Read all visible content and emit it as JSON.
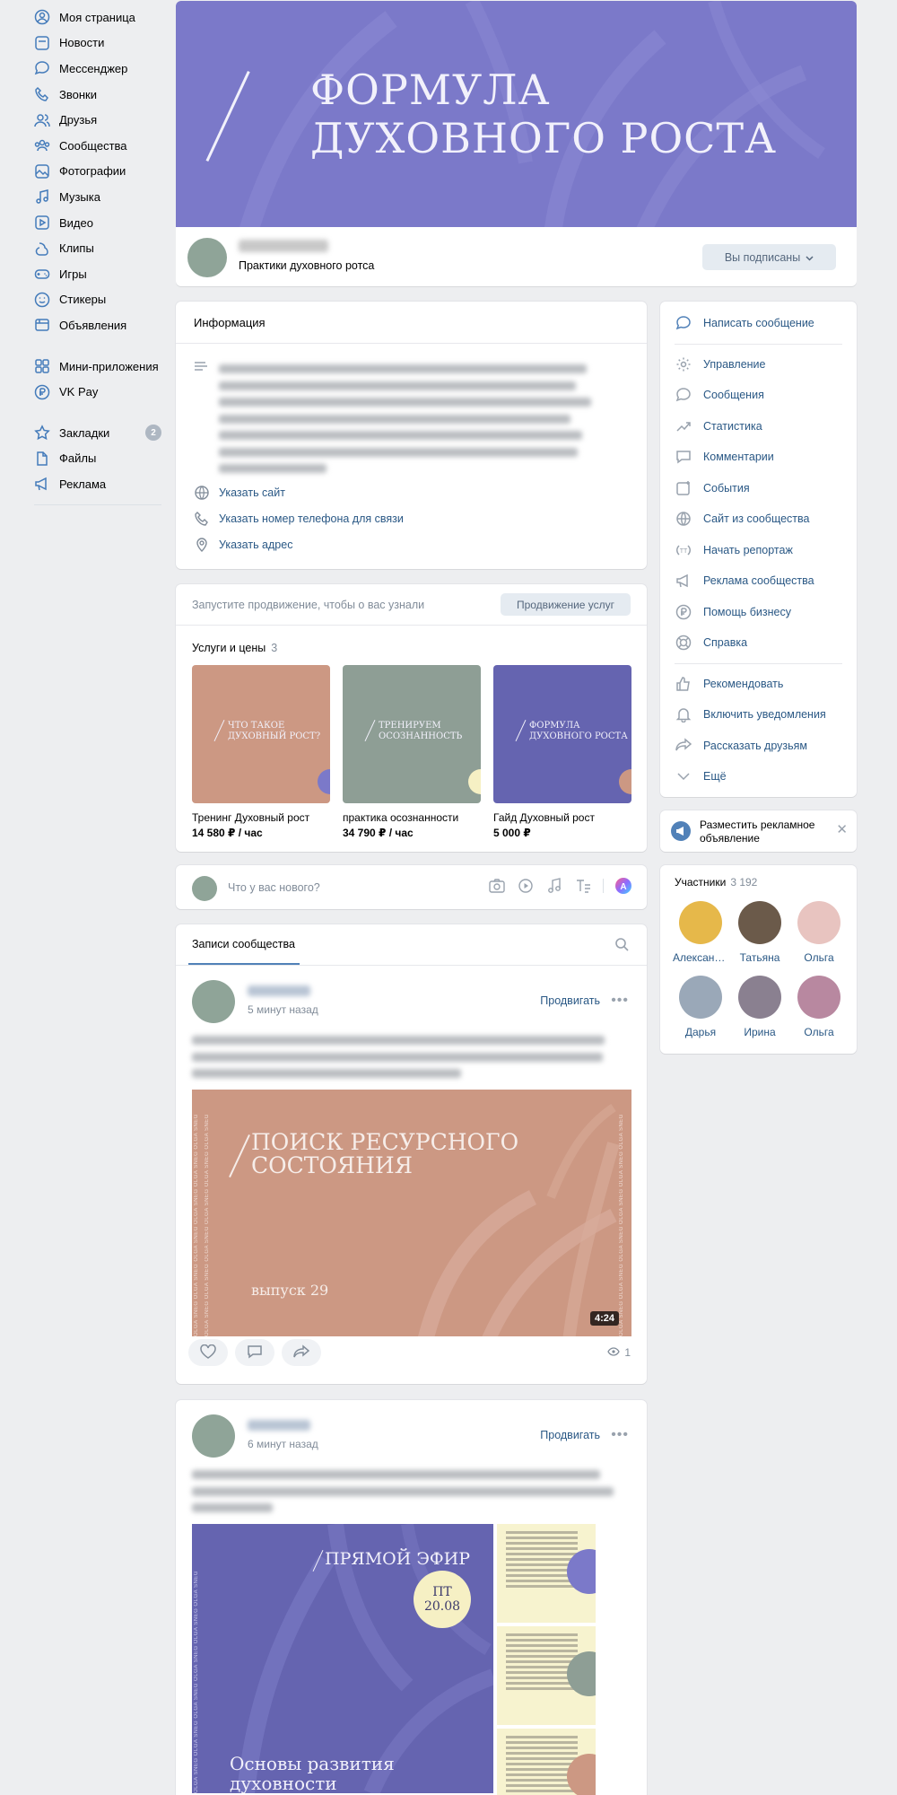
{
  "sidebar": {
    "items": [
      {
        "label": "Моя страница",
        "icon": "user-circle-icon"
      },
      {
        "label": "Новости",
        "icon": "news-icon"
      },
      {
        "label": "Мессенджер",
        "icon": "message-icon"
      },
      {
        "label": "Звонки",
        "icon": "phone-icon"
      },
      {
        "label": "Друзья",
        "icon": "friends-icon"
      },
      {
        "label": "Сообщества",
        "icon": "communities-icon"
      },
      {
        "label": "Фотографии",
        "icon": "photo-icon"
      },
      {
        "label": "Музыка",
        "icon": "music-icon"
      },
      {
        "label": "Видео",
        "icon": "video-icon"
      },
      {
        "label": "Клипы",
        "icon": "clips-icon"
      },
      {
        "label": "Игры",
        "icon": "games-icon"
      },
      {
        "label": "Стикеры",
        "icon": "stickers-icon"
      },
      {
        "label": "Объявления",
        "icon": "ads-icon"
      }
    ],
    "apps": [
      {
        "label": "Мини-приложения",
        "icon": "apps-icon"
      },
      {
        "label": "VK Pay",
        "icon": "vkpay-icon"
      }
    ],
    "extra": [
      {
        "label": "Закладки",
        "icon": "bookmark-icon",
        "badge": "2"
      },
      {
        "label": "Файлы",
        "icon": "file-icon"
      },
      {
        "label": "Реклама",
        "icon": "megaphone-icon"
      }
    ]
  },
  "cover": {
    "line1": "ФОРМУЛА",
    "line2": "ДУХОВНОГО РОСТА",
    "bg": "#7b79c9"
  },
  "header": {
    "description": "Практики духовного ротса",
    "subscribed_label": "Вы подписаны"
  },
  "info": {
    "title": "Информация",
    "links": [
      "Указать сайт",
      "Указать номер телефона для связи",
      "Указать адрес"
    ]
  },
  "promo": {
    "text": "Запустите продвижение, чтобы о вас узнали",
    "button": "Продвижение услуг"
  },
  "services": {
    "title": "Услуги и цены",
    "count": "3",
    "items": [
      {
        "image_line1": "ЧТО ТАКОЕ",
        "image_line2": "ДУХОВНЫЙ РОСТ?",
        "name": "Тренинг Духовный рост",
        "price": "14 580 ₽ / час",
        "bg": "#cc9883",
        "dot": "#7b79c9"
      },
      {
        "image_line1": "ТРЕНИРУЕМ",
        "image_line2": "ОСОЗНАННОСТЬ",
        "name": "практика осознанности",
        "price": "34 790 ₽ / час",
        "bg": "#8e9e95",
        "dot": "#f6f0c4"
      },
      {
        "image_line1": "ФОРМУЛА",
        "image_line2": "ДУХОВНОГО РОСТА",
        "name": "Гайд Духовный рост",
        "price": "5 000 ₽",
        "bg": "#6564b0",
        "dot": "#cc9883"
      }
    ]
  },
  "composer": {
    "placeholder": "Что у вас нового?"
  },
  "posts_tab": {
    "label": "Записи сообщества"
  },
  "posts": [
    {
      "time": "5 минут назад",
      "promote": "Продвигать",
      "video_title_1": "ПОИСК РЕСУРСНОГО",
      "video_title_2": "СОСТОЯНИЯ",
      "video_sub": "выпуск 29",
      "duration": "4:24",
      "vertical_text": "OLGA SNEG",
      "views": "1"
    },
    {
      "time": "6 минут назад",
      "promote": "Продвигать",
      "live_title": "ПРЯМОЙ ЭФИР",
      "badge_day": "ПТ",
      "badge_date": "20.08",
      "live_sub_1": "Основы развития",
      "live_sub_2": "духовности",
      "vertical_text": "OLGA SNEG"
    }
  ],
  "right_menu": {
    "primary": [
      {
        "label": "Написать сообщение",
        "icon": "message-icon"
      }
    ],
    "manage": [
      {
        "label": "Управление",
        "icon": "gear-icon"
      },
      {
        "label": "Сообщения",
        "icon": "message-icon"
      },
      {
        "label": "Статистика",
        "icon": "stats-icon"
      },
      {
        "label": "Комментарии",
        "icon": "comment-icon"
      },
      {
        "label": "События",
        "icon": "event-icon"
      },
      {
        "label": "Сайт из сообщества",
        "icon": "globe-icon"
      },
      {
        "label": "Начать репортаж",
        "icon": "live-icon"
      },
      {
        "label": "Реклама сообщества",
        "icon": "megaphone-icon"
      },
      {
        "label": "Помощь бизнесу",
        "icon": "ruble-icon"
      },
      {
        "label": "Справка",
        "icon": "help-icon"
      }
    ],
    "social": [
      {
        "label": "Рекомендовать",
        "icon": "like-icon"
      },
      {
        "label": "Включить уведомления",
        "icon": "bell-icon"
      },
      {
        "label": "Рассказать друзьям",
        "icon": "share-icon"
      },
      {
        "label": "Ещё",
        "icon": "chevron-down-icon"
      }
    ]
  },
  "ad_card": {
    "text": "Разместить рекламное объявление"
  },
  "members": {
    "title": "Участники",
    "count": "3 192",
    "list": [
      {
        "name": "Александ…",
        "color": "#e6b84a"
      },
      {
        "name": "Татьяна",
        "color": "#6b5a4a"
      },
      {
        "name": "Ольга",
        "color": "#e8c4c0"
      },
      {
        "name": "Дарья",
        "color": "#9aa8b8"
      },
      {
        "name": "Ирина",
        "color": "#8a8090"
      },
      {
        "name": "Ольга",
        "color": "#b888a0"
      }
    ]
  }
}
